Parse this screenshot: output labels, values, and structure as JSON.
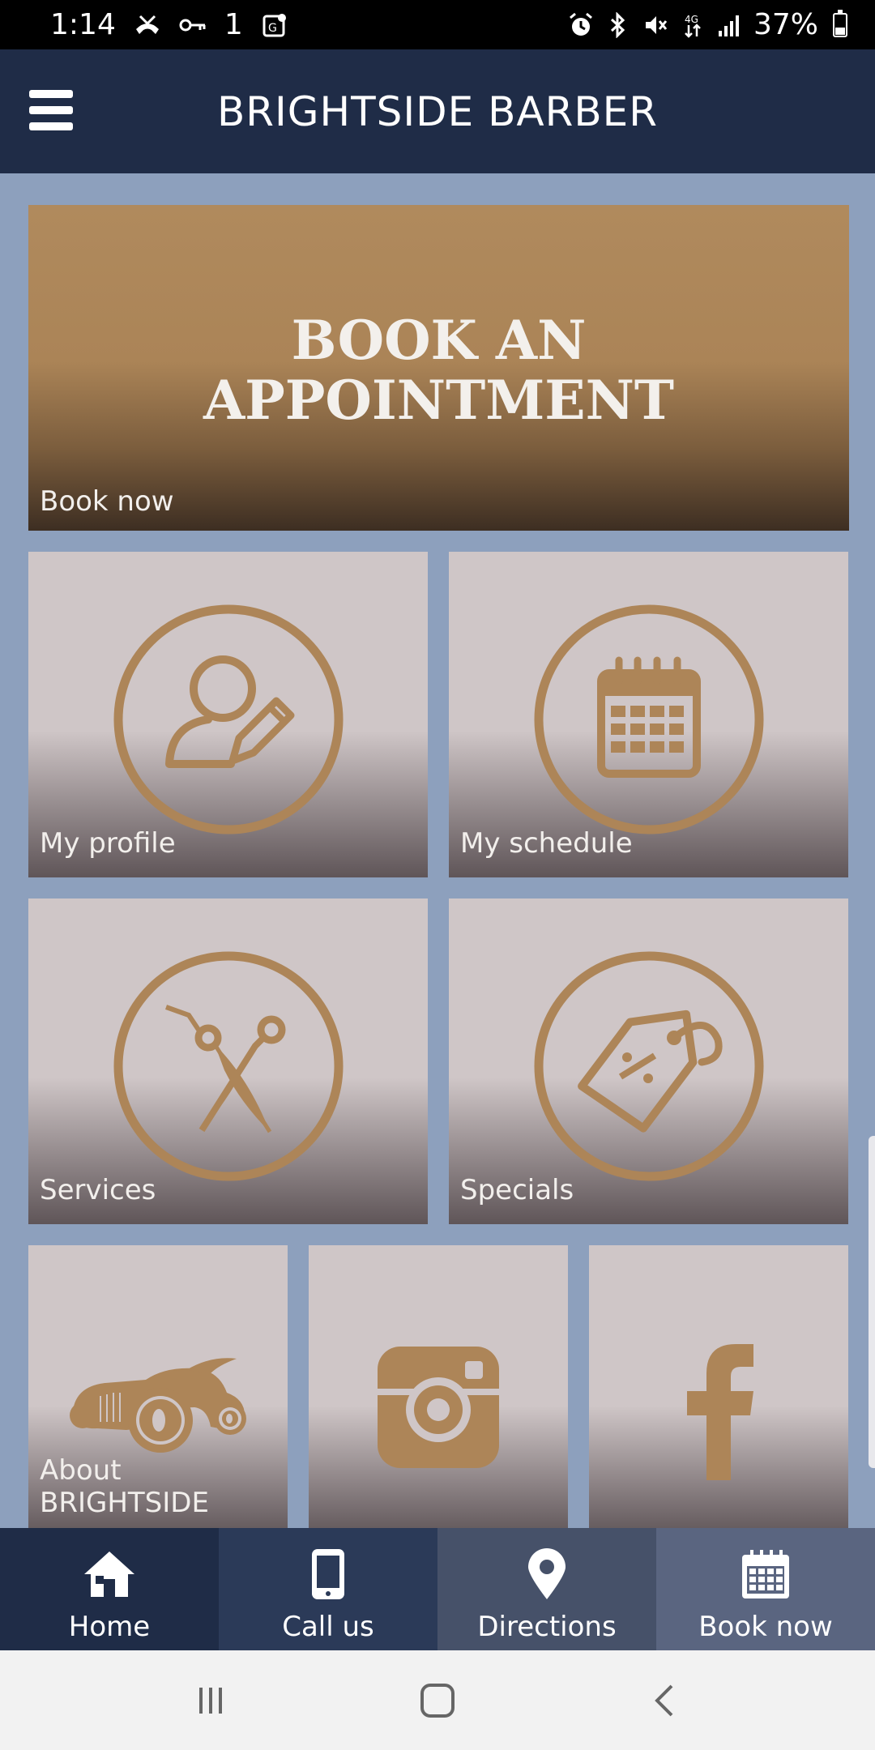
{
  "status_bar": {
    "time": "1:14",
    "notification_extra": "1",
    "battery_percent": "37%",
    "battery_level": 0.37
  },
  "app_bar": {
    "title": "BRIGHTSIDE BARBER",
    "menu_icon": "hamburger-menu-icon"
  },
  "hero": {
    "heading_line1": "BOOK AN",
    "heading_line2": "APPOINTMENT",
    "label": "Book now"
  },
  "tiles": [
    {
      "label": "My profile",
      "icon": "user-edit-icon"
    },
    {
      "label": "My schedule",
      "icon": "calendar-icon"
    },
    {
      "label": "Services",
      "icon": "scissors-icon"
    },
    {
      "label": "Specials",
      "icon": "price-tag-icon"
    },
    {
      "label": "About BRIGHTSIDE",
      "icon": "hot-rod-car-icon"
    },
    {
      "label": "",
      "icon": "instagram-icon"
    },
    {
      "label": "",
      "icon": "facebook-icon"
    }
  ],
  "bottom_nav": [
    {
      "label": "Home",
      "icon": "home-icon",
      "bg": "#1f2c47"
    },
    {
      "label": "Call us",
      "icon": "phone-icon",
      "bg": "#2b3a58"
    },
    {
      "label": "Directions",
      "icon": "map-pin-icon",
      "bg": "#465169"
    },
    {
      "label": "Book now",
      "icon": "calendar-icon",
      "bg": "#5a6580"
    }
  ],
  "colors": {
    "background": "#8da0bd",
    "app_bar": "#1f2c47",
    "accent_bronze": "#ad8558",
    "tile_bg": "#cfc6c7"
  }
}
